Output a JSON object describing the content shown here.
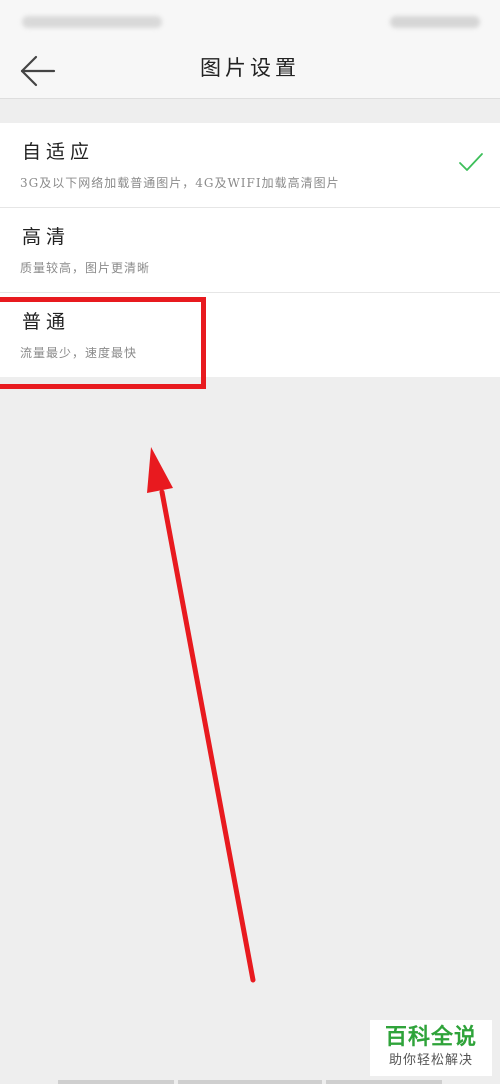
{
  "header": {
    "title": "图片设置",
    "back_icon": "arrow-left-icon"
  },
  "options": [
    {
      "title": "自适应",
      "description": "3G及以下网络加载普通图片，4G及WIFI加载高清图片",
      "selected": true
    },
    {
      "title": "高清",
      "description": "质量较高，图片更清晰",
      "selected": false
    },
    {
      "title": "普通",
      "description": "流量最少，速度最快",
      "selected": false
    }
  ],
  "annotation": {
    "color": "#e81a1f",
    "target": "普通"
  },
  "watermark": {
    "title": "百科全说",
    "subtitle": "助你轻松解决"
  },
  "colors": {
    "check": "#3dbf5a",
    "background": "#eeeeee"
  }
}
